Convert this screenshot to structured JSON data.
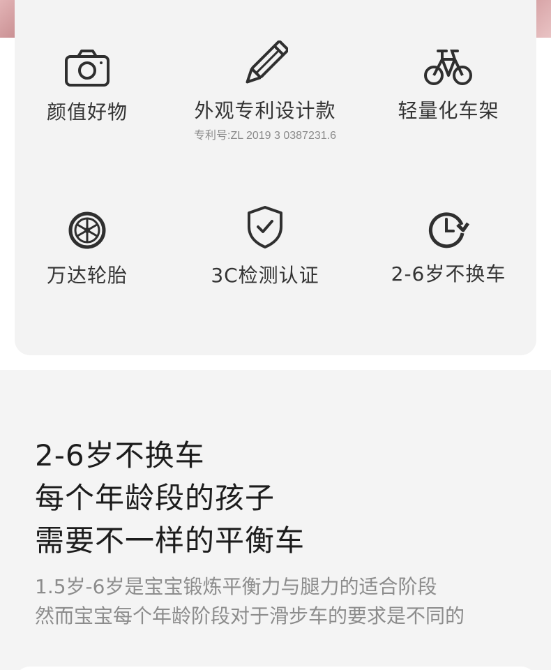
{
  "features": [
    {
      "icon": "camera-icon",
      "label": "颜值好物",
      "sub": ""
    },
    {
      "icon": "pencil-icon",
      "label": "外观专利设计款",
      "sub": "专利号:ZL 2019 3 0387231.6"
    },
    {
      "icon": "bicycle-icon",
      "label": "轻量化车架",
      "sub": ""
    },
    {
      "icon": "wheel-icon",
      "label": "万达轮胎",
      "sub": ""
    },
    {
      "icon": "shield-check-icon",
      "label": "3C检测认证",
      "sub": ""
    },
    {
      "icon": "clock-icon",
      "label": "2-6岁不换车",
      "sub": ""
    }
  ],
  "intro": {
    "headline": [
      "2-6岁不换车",
      "每个年龄段的孩子",
      "需要不一样的平衡车"
    ],
    "description": [
      "1.5岁-6岁是宝宝锻炼平衡力与腿力的适合阶段",
      "然而宝宝每个年龄阶段对于滑步车的要求是不同的"
    ]
  },
  "colors": {
    "card_bg": "#f3f3f3",
    "section_bg": "#f4f4f4",
    "icon_stroke": "#2f2f2f"
  }
}
